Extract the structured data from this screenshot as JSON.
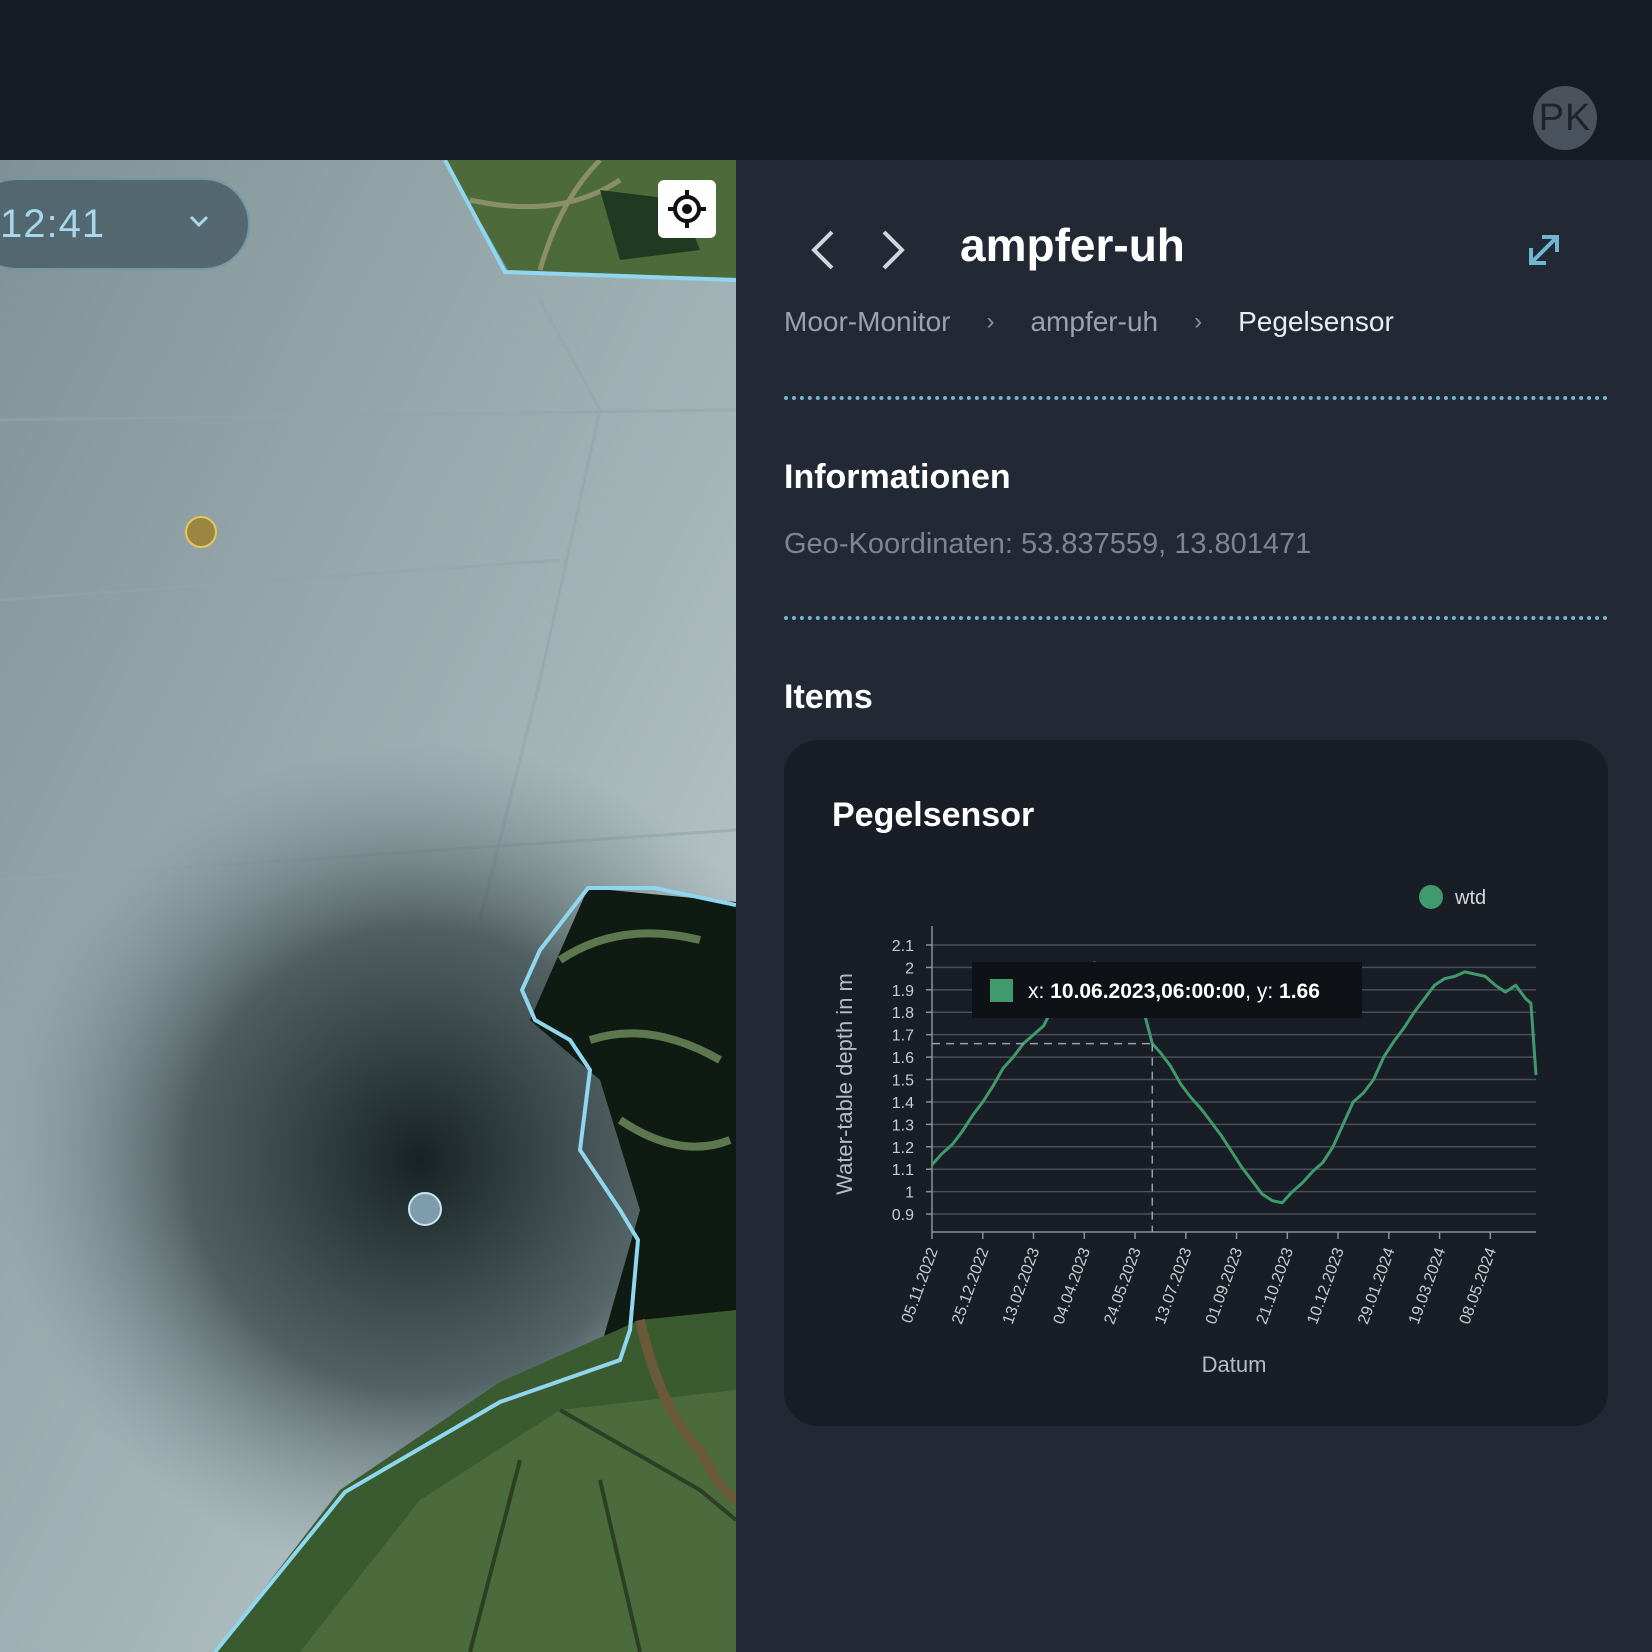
{
  "header": {
    "avatar_initials": "PK"
  },
  "map": {
    "time_value": "12:41",
    "dropdown_icon": "chevron-down-icon",
    "locate_icon": "crosshair-icon",
    "colors": {
      "boundary": "#8fd6ee",
      "marker_yellow": "#e8c65a",
      "marker_blue": "#c7e7f3"
    }
  },
  "panel": {
    "title": "ampfer-uh",
    "prev_icon": "chevron-left-icon",
    "next_icon": "chevron-right-icon",
    "expand_icon": "expand-icon",
    "breadcrumb": [
      {
        "label": "Moor-Monitor"
      },
      {
        "label": "ampfer-uh"
      },
      {
        "label": "Pegelsensor"
      }
    ],
    "breadcrumb_separator": "›",
    "info": {
      "heading": "Informationen",
      "geo_label": "Geo-Koordinaten:",
      "geo_value": "53.837559, 13.801471"
    },
    "items_heading": "Items"
  },
  "chart_card": {
    "title": "Pegelsensor"
  },
  "chart_data": {
    "type": "line",
    "title": "Pegelsensor",
    "xlabel": "Datum",
    "ylabel": "Water-table depth in m",
    "legend_position": "top-right",
    "ylim": [
      0.82,
      2.14
    ],
    "yticks": [
      "0.9",
      "1",
      "1.1",
      "1.2",
      "1.3",
      "1.4",
      "1.5",
      "1.6",
      "1.7",
      "1.8",
      "1.9",
      "2",
      "2.1"
    ],
    "xticks": [
      "05.11.2022",
      "25.12.2022",
      "13.02.2023",
      "04.04.2023",
      "24.05.2023",
      "13.07.2023",
      "01.09.2023",
      "21.10.2023",
      "10.12.2023",
      "29.01.2024",
      "19.03.2024",
      "08.05.2024"
    ],
    "x_start": "05.11.2022",
    "x_end": "22.06.2024",
    "grid": true,
    "color": "#3f9a6e",
    "series": [
      {
        "name": "wtd",
        "points": [
          [
            "05.11.2022",
            1.12
          ],
          [
            "15.11.2022",
            1.17
          ],
          [
            "25.11.2022",
            1.21
          ],
          [
            "05.12.2022",
            1.27
          ],
          [
            "15.12.2022",
            1.34
          ],
          [
            "25.12.2022",
            1.4
          ],
          [
            "04.01.2023",
            1.47
          ],
          [
            "14.01.2023",
            1.55
          ],
          [
            "24.01.2023",
            1.6
          ],
          [
            "03.02.2023",
            1.66
          ],
          [
            "13.02.2023",
            1.7
          ],
          [
            "23.02.2023",
            1.74
          ],
          [
            "05.03.2023",
            1.83
          ],
          [
            "15.03.2023",
            1.9
          ],
          [
            "25.03.2023",
            1.95
          ],
          [
            "04.04.2023",
            1.98
          ],
          [
            "14.04.2023",
            2.02
          ],
          [
            "24.04.2023",
            2.0
          ],
          [
            "04.05.2023",
            1.95
          ],
          [
            "14.05.2023",
            1.9
          ],
          [
            "24.05.2023",
            1.86
          ],
          [
            "03.06.2023",
            1.78
          ],
          [
            "10.06.2023",
            1.66
          ],
          [
            "18.06.2023",
            1.62
          ],
          [
            "28.06.2023",
            1.56
          ],
          [
            "08.07.2023",
            1.48
          ],
          [
            "18.07.2023",
            1.42
          ],
          [
            "28.07.2023",
            1.37
          ],
          [
            "07.08.2023",
            1.31
          ],
          [
            "17.08.2023",
            1.25
          ],
          [
            "27.08.2023",
            1.18
          ],
          [
            "06.09.2023",
            1.11
          ],
          [
            "16.09.2023",
            1.05
          ],
          [
            "26.09.2023",
            0.99
          ],
          [
            "06.10.2023",
            0.96
          ],
          [
            "16.10.2023",
            0.95
          ],
          [
            "26.10.2023",
            1.0
          ],
          [
            "05.11.2023",
            1.04
          ],
          [
            "15.11.2023",
            1.09
          ],
          [
            "25.11.2023",
            1.13
          ],
          [
            "05.12.2023",
            1.2
          ],
          [
            "15.12.2023",
            1.3
          ],
          [
            "25.12.2023",
            1.4
          ],
          [
            "04.01.2024",
            1.44
          ],
          [
            "14.01.2024",
            1.5
          ],
          [
            "24.01.2024",
            1.6
          ],
          [
            "03.02.2024",
            1.67
          ],
          [
            "13.02.2024",
            1.73
          ],
          [
            "23.02.2024",
            1.8
          ],
          [
            "04.03.2024",
            1.86
          ],
          [
            "14.03.2024",
            1.92
          ],
          [
            "24.03.2024",
            1.95
          ],
          [
            "03.04.2024",
            1.96
          ],
          [
            "13.04.2024",
            1.98
          ],
          [
            "23.04.2024",
            1.97
          ],
          [
            "03.05.2024",
            1.96
          ],
          [
            "13.05.2024",
            1.92
          ],
          [
            "23.05.2024",
            1.89
          ],
          [
            "02.06.2024",
            1.92
          ],
          [
            "12.06.2024",
            1.86
          ],
          [
            "17.06.2024",
            1.84
          ],
          [
            "22.06.2024",
            1.52
          ]
        ]
      }
    ],
    "tooltip": {
      "x_label": "x:",
      "x_value": "10.06.2023,06:00:00",
      "y_label": "y:",
      "y_value": "1.66",
      "x": "10.06.2023",
      "y": 1.66
    }
  }
}
